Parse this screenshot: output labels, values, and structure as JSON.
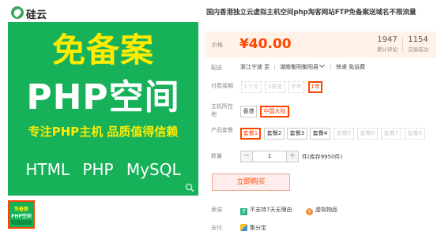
{
  "promo": {
    "logo_text": "硅云",
    "headline": "免备案",
    "main": "PHP空间",
    "slogan": "专注PHP主机  品质值得信赖",
    "tech": "HTML  PHP  MySQL"
  },
  "thumbnail": {
    "line1": "免备案",
    "line2": "PHP空间"
  },
  "product": {
    "title": "国内香港独立云虚拟主机空间php淘客网站FTP免备案送域名不限流量"
  },
  "price": {
    "label": "价格",
    "value": "¥40.00",
    "reviews_count": "1947",
    "reviews_label": "累计评论",
    "sales_count": "1154",
    "sales_label": "交易成功"
  },
  "shipping": {
    "label": "配送",
    "from": "浙江宁波 至",
    "to": "湖南衡阳衡阳县",
    "express": "快递 免运费"
  },
  "period": {
    "label": "付费周期",
    "options": [
      "1个月",
      "3季度",
      "半年",
      "1年"
    ],
    "selected": "1年"
  },
  "region": {
    "label": "主机所在地",
    "options": [
      "香港",
      "中国大陆"
    ],
    "selected": "中国大陆"
  },
  "package": {
    "label": "产品套餐",
    "options": [
      "套餐1",
      "套餐2",
      "套餐3",
      "套餐4",
      "套餐5",
      "套餐6",
      "套餐7",
      "套餐8"
    ],
    "selected": "套餐1"
  },
  "quantity": {
    "label": "数量",
    "value": "1",
    "minus": "−",
    "plus": "+",
    "stock": "件(库存9950件)"
  },
  "buy_button": "立即购买",
  "promise": {
    "label": "承诺",
    "item1_badge": "7",
    "item1": "不支持7天无理由",
    "item2_badge": "V",
    "item2": "虚拟物品"
  },
  "payment": {
    "label": "支付",
    "method": "集分宝"
  },
  "colors": {
    "accent": "#ff4400",
    "promo_green": "#17b15a",
    "promo_yellow": "#ffeb00",
    "price_bg": "#fff2e8"
  }
}
